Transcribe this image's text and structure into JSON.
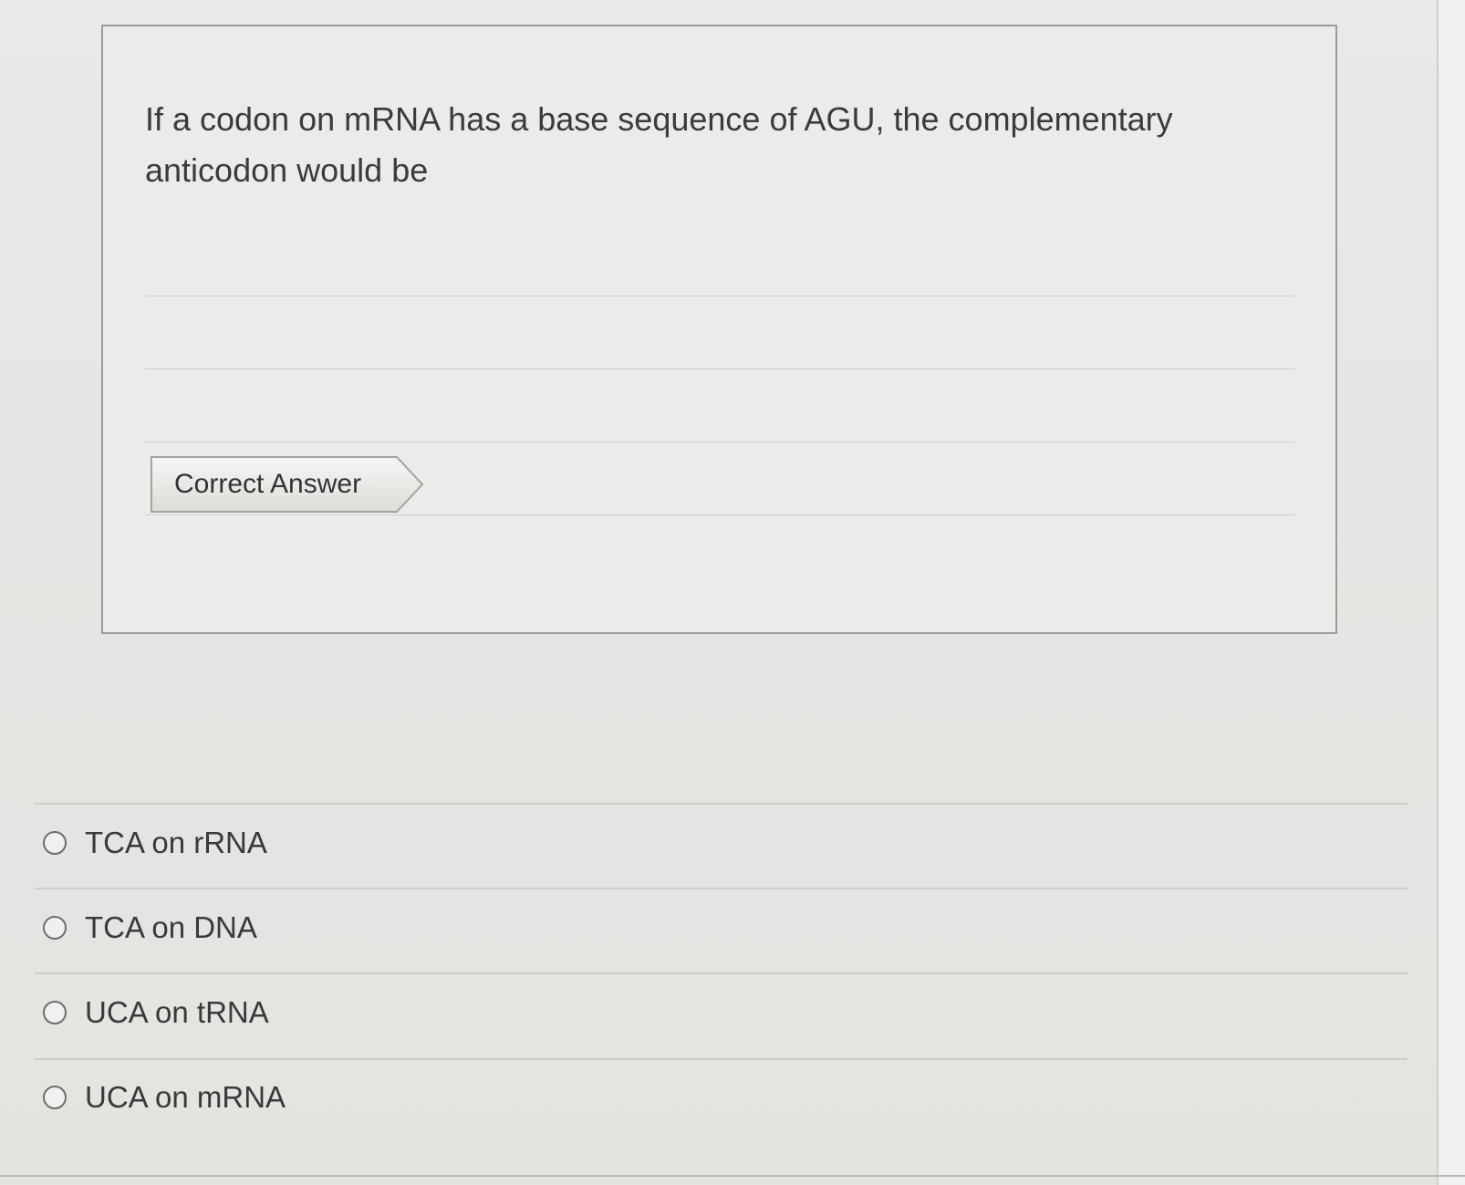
{
  "question": {
    "text": "If a codon on mRNA has a base sequence of AGU, the complementary anticodon would be"
  },
  "correct_answer": {
    "label": "Correct Answer"
  },
  "options": [
    {
      "label": "TCA on rRNA",
      "selected": false
    },
    {
      "label": "TCA on DNA",
      "selected": false
    },
    {
      "label": "UCA on tRNA",
      "selected": false
    },
    {
      "label": "UCA on mRNA",
      "selected": false
    }
  ]
}
